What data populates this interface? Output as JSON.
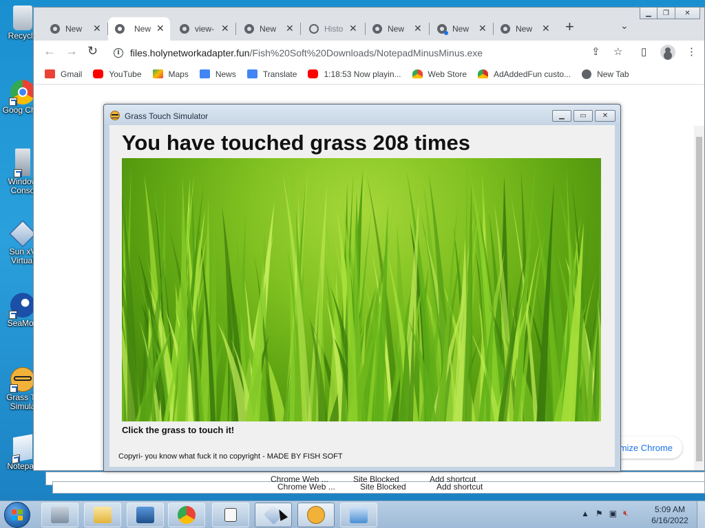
{
  "desktop": {
    "icons": [
      {
        "label": "Recycle",
        "icon": "recycle-bin-icon"
      },
      {
        "label": "Goog Chro",
        "icon": "chrome-icon"
      },
      {
        "label": "Window Conso",
        "icon": "computer-icon"
      },
      {
        "label": "Sun xV Virtual",
        "icon": "virtualbox-icon"
      },
      {
        "label": "SeaMon",
        "icon": "seamonkey-icon"
      },
      {
        "label": "Grass To Simula",
        "icon": "nerd-face-icon"
      },
      {
        "label": "Notepad",
        "icon": "notepad-icon"
      }
    ]
  },
  "chrome": {
    "tabs": [
      {
        "title": "New",
        "icon": "chrome-icon"
      },
      {
        "title": "New",
        "icon": "chrome-icon"
      },
      {
        "title": "view-",
        "icon": "chrome-icon"
      },
      {
        "title": "New",
        "icon": "chrome-icon"
      },
      {
        "title": "Histo",
        "icon": "history-icon"
      },
      {
        "title": "New",
        "icon": "chrome-icon"
      },
      {
        "title": "New",
        "icon": "chrome-icon"
      },
      {
        "title": "New",
        "icon": "chrome-icon"
      }
    ],
    "close_glyph": "✕",
    "new_tab_glyph": "+",
    "tab_list_glyph": "⌄",
    "address": {
      "host": "files.holynetworkadapter.fun",
      "path": "/Fish%20Soft%20Downloads/NotepadMinusMinus.exe"
    },
    "bookmarks": [
      {
        "label": "Gmail",
        "color": "#ea4335"
      },
      {
        "label": "YouTube",
        "color": "#ff0000"
      },
      {
        "label": "Maps",
        "color": "#34a853"
      },
      {
        "label": "News",
        "color": "#4285f4"
      },
      {
        "label": "Translate",
        "color": "#4285f4"
      },
      {
        "label": "1:18:53 Now playin...",
        "color": "#ff0000"
      },
      {
        "label": "Web Store",
        "color": "#fbbc04"
      },
      {
        "label": "AdAddedFun custo...",
        "color": "#d93025"
      },
      {
        "label": "New Tab",
        "color": "#5f6368"
      }
    ],
    "customize_label": "mize Chrome"
  },
  "behind_text": {
    "row1": [
      "Chrome Web ...",
      "Site Blocked",
      "Add shortcut"
    ],
    "row2": [
      "Chrome Web ...",
      "Site Blocked",
      "Add shortcut"
    ]
  },
  "grass_window": {
    "title": "Grass Touch Simulator",
    "heading": "You have touched grass 208 times",
    "touch_count": 208,
    "instruction": "Click the grass to touch it!",
    "footer": "Copyri- you know what fuck it no copyright - MADE BY FISH SOFT"
  },
  "taskbar": {
    "apps": [
      {
        "name": "server-manager-icon",
        "color": "#8a9bb0"
      },
      {
        "name": "explorer-icon",
        "color": "#f2c94c"
      },
      {
        "name": "powershell-icon",
        "color": "#2f6fb8"
      },
      {
        "name": "chrome-icon",
        "color": "#ea4335"
      },
      {
        "name": "folder-icon",
        "color": "#f5f5f5"
      },
      {
        "name": "virtualbox-icon",
        "color": "#a7bfd8"
      },
      {
        "name": "nerd-face-icon",
        "color": "#f2b23a"
      },
      {
        "name": "control-panel-icon",
        "color": "#4a8fd4"
      }
    ],
    "time": "5:09 AM",
    "date": "6/16/2022"
  }
}
